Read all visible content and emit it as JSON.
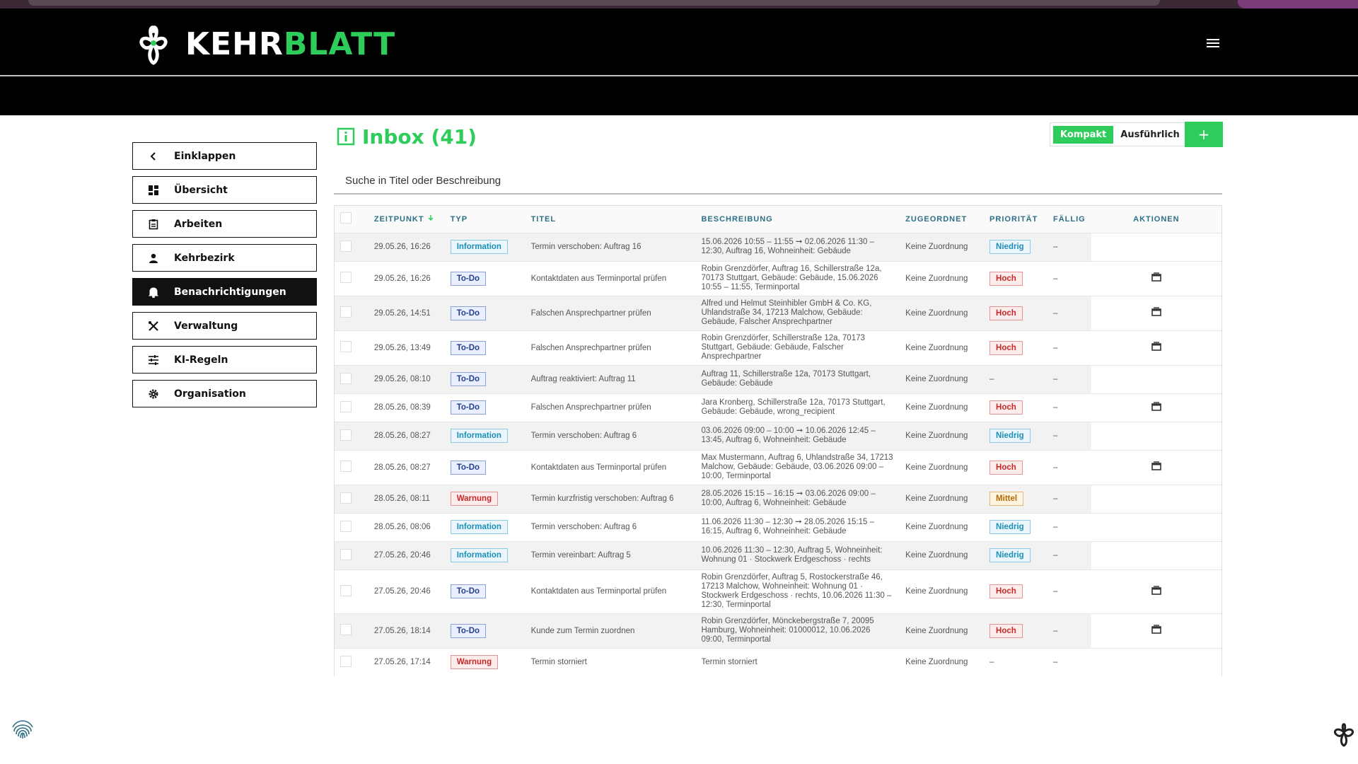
{
  "brand": {
    "name_part1": "KEHR",
    "name_part2": "BLATT"
  },
  "sidebar": {
    "items": [
      {
        "label": "Einklappen",
        "icon": "chevron-left-icon"
      },
      {
        "label": "Übersicht",
        "icon": "dashboard-icon"
      },
      {
        "label": "Arbeiten",
        "icon": "clipboard-icon"
      },
      {
        "label": "Kehrbezirk",
        "icon": "person-icon"
      },
      {
        "label": "Benachrichtigungen",
        "icon": "bell-icon",
        "active": true
      },
      {
        "label": "Verwaltung",
        "icon": "tools-icon"
      },
      {
        "label": "KI-Regeln",
        "icon": "sliders-icon"
      },
      {
        "label": "Organisation",
        "icon": "gear-icon"
      }
    ]
  },
  "main": {
    "title": "Inbox (41)",
    "view_compact": "Kompakt",
    "view_detailed": "Ausführlich",
    "add_label": "+",
    "search_placeholder": "Suche in Titel oder Beschreibung"
  },
  "table": {
    "headers": [
      "ZEITPUNKT",
      "TYP",
      "TITEL",
      "BESCHREIBUNG",
      "ZUGEORDNET",
      "PRIORITÄT",
      "FÄLLIG",
      "AKTIONEN"
    ],
    "sort_icon": "arrow-down-icon",
    "rows": [
      {
        "time": "29.05.26, 16:26",
        "type": "Information",
        "title": "Termin verschoben: Auftrag 16",
        "desc": "15.06.2026 10:55 – 11:55 ➞ 02.06.2026 11:30 – 12:30, Auftrag 16, Wohneinheit: Gebäude",
        "assigned": "Keine Zuordnung",
        "priority": "Niedrig",
        "due": "–",
        "action": false
      },
      {
        "time": "29.05.26, 16:26",
        "type": "To-Do",
        "title": "Kontaktdaten aus Terminportal prüfen",
        "desc": "Robin Grenzdörfer, Auftrag 16, Schillerstraße 12a, 70173 Stuttgart, Gebäude: Gebäude, 15.06.2026 10:55 – 11:55, Terminportal",
        "assigned": "Keine Zuordnung",
        "priority": "Hoch",
        "due": "–",
        "action": true
      },
      {
        "time": "29.05.26, 14:51",
        "type": "To-Do",
        "title": "Falschen Ansprechpartner prüfen",
        "desc": "Alfred und Helmut Steinhibler GmbH & Co. KG, Uhlandstraße 34, 17213 Malchow, Gebäude: Gebäude, Falscher Ansprechpartner",
        "assigned": "Keine Zuordnung",
        "priority": "Hoch",
        "due": "–",
        "action": true
      },
      {
        "time": "29.05.26, 13:49",
        "type": "To-Do",
        "title": "Falschen Ansprechpartner prüfen",
        "desc": "Robin Grenzdörfer, Schillerstraße 12a, 70173 Stuttgart, Gebäude: Gebäude, Falscher Ansprechpartner",
        "assigned": "Keine Zuordnung",
        "priority": "Hoch",
        "due": "–",
        "action": true
      },
      {
        "time": "29.05.26, 08:10",
        "type": "To-Do",
        "title": "Auftrag reaktiviert: Auftrag 11",
        "desc": "Auftrag 11, Schillerstraße 12a, 70173 Stuttgart, Gebäude: Gebäude",
        "assigned": "Keine Zuordnung",
        "priority": "–",
        "due": "–",
        "action": false
      },
      {
        "time": "28.05.26, 08:39",
        "type": "To-Do",
        "title": "Falschen Ansprechpartner prüfen",
        "desc": "Jara Kronberg, Schillerstraße 12a, 70173 Stuttgart, Gebäude: Gebäude, wrong_recipient",
        "assigned": "Keine Zuordnung",
        "priority": "Hoch",
        "due": "–",
        "action": true
      },
      {
        "time": "28.05.26, 08:27",
        "type": "Information",
        "title": "Termin verschoben: Auftrag 6",
        "desc": "03.06.2026 09:00 – 10:00 ➞ 10.06.2026 12:45 – 13:45, Auftrag 6, Wohneinheit: Gebäude",
        "assigned": "Keine Zuordnung",
        "priority": "Niedrig",
        "due": "–",
        "action": false
      },
      {
        "time": "28.05.26, 08:27",
        "type": "To-Do",
        "title": "Kontaktdaten aus Terminportal prüfen",
        "desc": "Max Mustermann, Auftrag 6, Uhlandstraße 34, 17213 Malchow, Gebäude: Gebäude, 03.06.2026 09:00 – 10:00, Terminportal",
        "assigned": "Keine Zuordnung",
        "priority": "Hoch",
        "due": "–",
        "action": true
      },
      {
        "time": "28.05.26, 08:11",
        "type": "Warnung",
        "title": "Termin kurzfristig verschoben: Auftrag 6",
        "desc": "28.05.2026 15:15 – 16:15 ➞ 03.06.2026 09:00 – 10:00, Auftrag 6, Wohneinheit: Gebäude",
        "assigned": "Keine Zuordnung",
        "priority": "Mittel",
        "due": "–",
        "action": false
      },
      {
        "time": "28.05.26, 08:06",
        "type": "Information",
        "title": "Termin verschoben: Auftrag 6",
        "desc": "11.06.2026 11:30 – 12:30 ➞ 28.05.2026 15:15 – 16:15, Auftrag 6, Wohneinheit: Gebäude",
        "assigned": "Keine Zuordnung",
        "priority": "Niedrig",
        "due": "–",
        "action": false
      },
      {
        "time": "27.05.26, 20:46",
        "type": "Information",
        "title": "Termin vereinbart: Auftrag 5",
        "desc": "10.06.2026 11:30 – 12:30, Auftrag 5, Wohneinheit: Wohnung 01 · Stockwerk Erdgeschoss · rechts",
        "assigned": "Keine Zuordnung",
        "priority": "Niedrig",
        "due": "–",
        "action": false
      },
      {
        "time": "27.05.26, 20:46",
        "type": "To-Do",
        "title": "Kontaktdaten aus Terminportal prüfen",
        "desc": "Robin Grenzdörfer, Auftrag 5, Rostockerstraße 46, 17213 Malchow, Wohneinheit: Wohnung 01 · Stockwerk Erdgeschoss · rechts, 10.06.2026 11:30 – 12:30, Terminportal",
        "assigned": "Keine Zuordnung",
        "priority": "Hoch",
        "due": "–",
        "action": true
      },
      {
        "time": "27.05.26, 18:14",
        "type": "To-Do",
        "title": "Kunde zum Termin zuordnen",
        "desc": "Robin Grenzdörfer, Mönckebergstraße 7, 20095 Hamburg, Wohneinheit: 01000012, 10.06.2026 09:00, Terminportal",
        "assigned": "Keine Zuordnung",
        "priority": "Hoch",
        "due": "–",
        "action": true
      },
      {
        "time": "27.05.26, 17:14",
        "type": "Warnung",
        "title": "Termin storniert",
        "desc": "Termin storniert",
        "assigned": "Keine Zuordnung",
        "priority": "–",
        "due": "–",
        "action": false
      }
    ]
  },
  "colors": {
    "accent": "#2ecc5a",
    "header_bg": "#000000",
    "info": "#1b8fb8",
    "todo": "#223f8a",
    "warn": "#c62828"
  }
}
